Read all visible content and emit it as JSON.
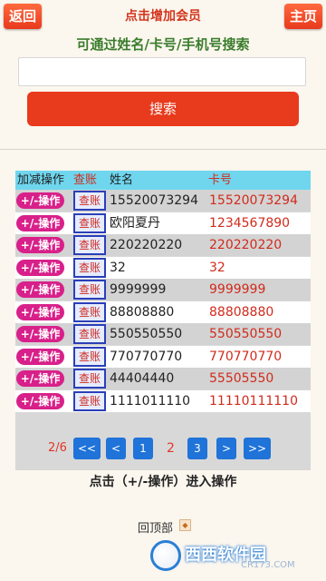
{
  "header": {
    "back_label": "返回",
    "home_label": "主页",
    "add_member_label": "点击增加会员"
  },
  "search": {
    "hint": "可通过姓名/卡号/手机号搜索",
    "value": "",
    "button_label": "搜索"
  },
  "table": {
    "headers": {
      "ops": "加减操作",
      "query": "查账",
      "name": "姓名",
      "card": "卡号"
    },
    "op_label": "+/-操作",
    "query_label": "查账",
    "rows": [
      {
        "name": "15520073294",
        "card": "15520073294"
      },
      {
        "name": "欧阳夏丹",
        "card": "1234567890"
      },
      {
        "name": "220220220",
        "card": "220220220"
      },
      {
        "name": "32",
        "card": "32"
      },
      {
        "name": "9999999",
        "card": "9999999"
      },
      {
        "name": "88808880",
        "card": "88808880"
      },
      {
        "name": "550550550",
        "card": "550550550"
      },
      {
        "name": "770770770",
        "card": "770770770"
      },
      {
        "name": "44404440",
        "card": "55505550"
      },
      {
        "name": "1111011110",
        "card": "11110111110"
      }
    ]
  },
  "pagination": {
    "info": "2/6",
    "first": "<<",
    "prev": "<",
    "page_1": "1",
    "current": "2",
    "page_3": "3",
    "next": ">",
    "last": ">>"
  },
  "footer": {
    "enter_hint": "点击（+/-操作）进入操作",
    "back_top": "回顶部"
  },
  "watermark": {
    "brand": "西西软件园",
    "sub": "CR173.COM"
  },
  "colors": {
    "accent_red": "#e83a1c",
    "op_button": "#d8208a",
    "header_cyan": "#6fd6ee",
    "pager_blue": "#1f73d9",
    "hint_green": "#3a7d2c"
  }
}
